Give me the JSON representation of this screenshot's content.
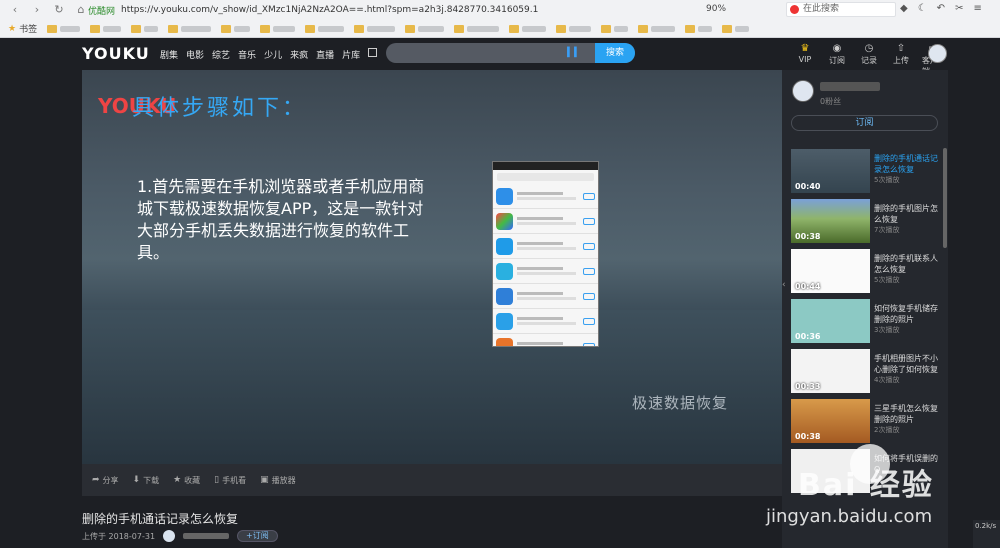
{
  "browser": {
    "site_label": "优酷网",
    "url": "https://v.youku.com/v_show/id_XMzc1NjA2NzA2OA==.html?spm=a2h3j.8428770.3416059.1",
    "zoom": "90%",
    "search_placeholder": "在此搜索",
    "bookmarks_label": "书签"
  },
  "header": {
    "logo": "YOUKU",
    "channels": [
      "剧集",
      "电影",
      "综艺",
      "音乐",
      "少儿",
      "来疯",
      "直播",
      "片库"
    ],
    "search_button": "搜索",
    "tools": [
      {
        "label": "VIP",
        "icon": "crown-icon"
      },
      {
        "label": "订阅",
        "icon": "rss-icon"
      },
      {
        "label": "记录",
        "icon": "clock-icon"
      },
      {
        "label": "上传",
        "icon": "upload-icon"
      },
      {
        "label": "客户端",
        "icon": "monitor-icon"
      }
    ]
  },
  "video": {
    "watermark": "YOUKU",
    "heading": "具体步骤如下：",
    "body": "1.首先需要在手机浏览器或者手机应用商城下载极速数据恢复APP，这是一款针对大部分手机丢失数据进行恢复的软件工具。",
    "caption": "极速数据恢复"
  },
  "controls": [
    {
      "label": "分享",
      "icon": "share-icon"
    },
    {
      "label": "下载",
      "icon": "download-icon"
    },
    {
      "label": "收藏",
      "icon": "star-icon"
    },
    {
      "label": "手机看",
      "icon": "phone-icon"
    },
    {
      "label": "播放器",
      "icon": "player-icon"
    }
  ],
  "info": {
    "title": "删除的手机通话记录怎么恢复",
    "upload_date": "上传于 2018-07-31",
    "subscribe": "+订阅"
  },
  "sidebar": {
    "channel_meta": "0粉丝",
    "subscribe": "订阅",
    "items": [
      {
        "title": "删除的手机通话记录怎么恢复",
        "plays": "5次播放",
        "duration": "00:40",
        "active": true
      },
      {
        "title": "删除的手机图片怎么恢复",
        "plays": "7次播放",
        "duration": "00:38"
      },
      {
        "title": "删除的手机联系人怎么恢复",
        "plays": "5次播放",
        "duration": "00:44"
      },
      {
        "title": "如何恢复手机储存删除的照片",
        "plays": "3次播放",
        "duration": "00:36"
      },
      {
        "title": "手机相册图片不小心删除了如何恢复",
        "plays": "4次播放",
        "duration": "00:33"
      },
      {
        "title": "三星手机怎么恢复删除的照片",
        "plays": "2次播放",
        "duration": "00:38"
      },
      {
        "title": "如何将手机误删的Q",
        "plays": "",
        "duration": ""
      }
    ]
  },
  "overlay": {
    "baidu_word": "Bai 经验",
    "baidu_url": "jingyan.baidu.com",
    "speed": "0.2k/s"
  }
}
